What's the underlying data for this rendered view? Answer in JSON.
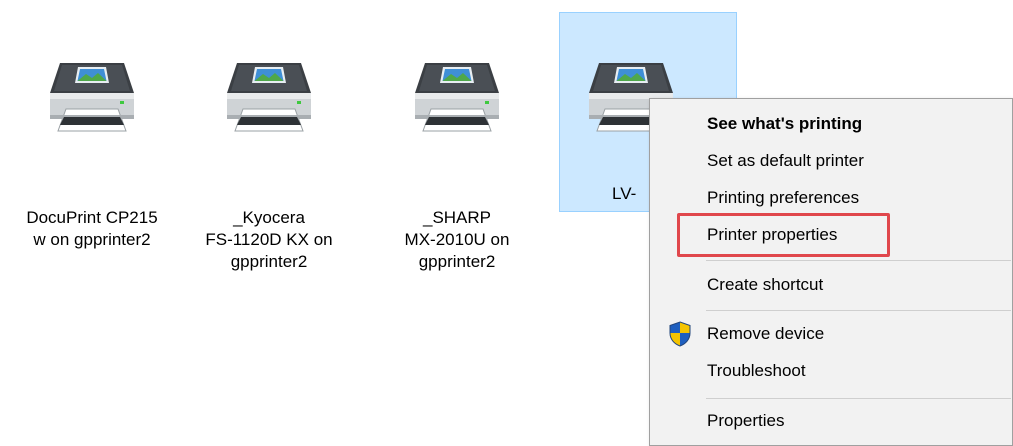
{
  "devices": [
    {
      "label_lines": [
        "DocuPrint CP215",
        "w on gpprinter2"
      ],
      "selected": false
    },
    {
      "label_lines": [
        "_Kyocera",
        "FS-1120D KX on",
        "gpprinter2"
      ],
      "selected": false
    },
    {
      "label_lines": [
        "_SHARP",
        "MX-2010U on",
        "gpprinter2"
      ],
      "selected": false
    },
    {
      "label_lines": [
        "LV-"
      ],
      "selected": true
    }
  ],
  "context_menu": {
    "items": [
      {
        "id": "see-whats-printing",
        "label": "See what's printing",
        "bold": true
      },
      {
        "id": "set-as-default-printer",
        "label": "Set as default printer",
        "bold": false
      },
      {
        "id": "printing-preferences",
        "label": "Printing preferences",
        "bold": false
      },
      {
        "id": "printer-properties",
        "label": "Printer properties",
        "bold": false,
        "highlighted": true
      },
      {
        "id": "create-shortcut",
        "label": "Create shortcut",
        "bold": false
      },
      {
        "id": "remove-device",
        "label": "Remove device",
        "bold": false,
        "icon": "uac-shield-icon"
      },
      {
        "id": "troubleshoot",
        "label": "Troubleshoot",
        "bold": false
      },
      {
        "id": "properties",
        "label": "Properties",
        "bold": false
      }
    ]
  },
  "colors": {
    "selection_bg": "#cce8ff",
    "selection_border": "#99d1ff",
    "menu_bg": "#f2f2f2",
    "highlight_border": "#e0474c"
  }
}
